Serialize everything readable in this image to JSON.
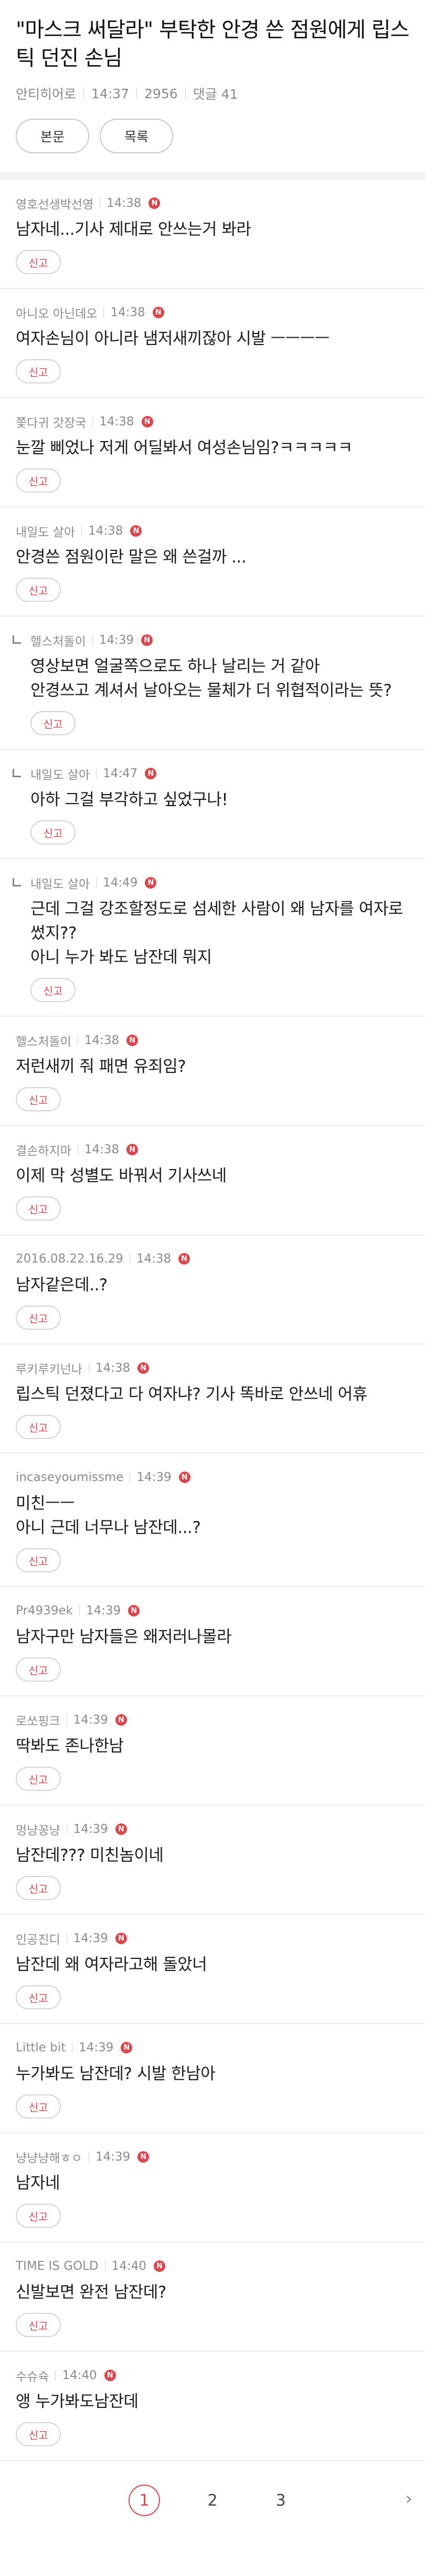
{
  "article": {
    "title": "\"마스크 써달라\" 부탁한 안경 쓴 점원에게 립스틱 던진 손님",
    "author": "안티히어로",
    "time": "14:37",
    "views": "2956",
    "comments_label": "댓글 41",
    "buttons": {
      "body": "본문",
      "list": "목록"
    }
  },
  "report_label": "신고",
  "new_badge": "N",
  "comments": [
    {
      "author": "영호선생박선영",
      "time": "14:38",
      "text": "남자네...기사 제대로 안쓰는거 봐라"
    },
    {
      "author": "아니오 아닌데오",
      "time": "14:38",
      "text": "여자손님이 아니라 냄저새끼잖아 시발 ㅡㅡㅡㅡ"
    },
    {
      "author": "쫓다귀 갓장국",
      "time": "14:38",
      "text": "눈깔 삐었나 저게 어딜봐서 여성손님임?ㅋㅋㅋㅋㅋ"
    },
    {
      "author": "내일도 살아",
      "time": "14:38",
      "text": "안경쓴 점원이란 말은 왜 쓴걸까 ..."
    },
    {
      "author": "헬스처돌이",
      "time": "14:39",
      "text": "영상보면 얼굴쪽으로도 하나 날리는 거 같아\n안경쓰고 계셔서 날아오는 물체가 더 위협적이라는 뜻?",
      "reply": true
    },
    {
      "author": "내일도 살아",
      "time": "14:47",
      "text": "아하 그걸 부각하고 싶었구나!",
      "reply": true
    },
    {
      "author": "내일도 살아",
      "time": "14:49",
      "text": "근데 그걸 강조할정도로 섬세한 사람이 왜 남자를 여자로 썼지??\n아니 누가 봐도 남잔데 뭐지",
      "reply": true
    },
    {
      "author": "헬스처돌이",
      "time": "14:38",
      "text": "저런새끼 줘 패면 유죄임?"
    },
    {
      "author": "결손하지마",
      "time": "14:38",
      "text": "이제 막 성별도 바꿔서 기사쓰네"
    },
    {
      "author": "2016.08.22.16.29",
      "time": "14:38",
      "text": "남자같은데..?"
    },
    {
      "author": "루키루키넌나",
      "time": "14:38",
      "text": "립스틱 던졌다고 다 여자냐? 기사 똑바로 안쓰네 어휴"
    },
    {
      "author": "incaseyoumissme",
      "time": "14:39",
      "text": "미친ㅡㅡ\n아니 근데 너무나 남잔데...?"
    },
    {
      "author": "Pr4939ek",
      "time": "14:39",
      "text": "남자구만 남자들은 왜저러나몰라"
    },
    {
      "author": "로쏘핑크",
      "time": "14:39",
      "text": "딱봐도 존나한남"
    },
    {
      "author": "멍냥꽁냥",
      "time": "14:39",
      "text": "남잔데??? 미친놈이네"
    },
    {
      "author": "인공진디",
      "time": "14:39",
      "text": "남잔데 왜 여자라고해 돌았너"
    },
    {
      "author": "Little bit",
      "time": "14:39",
      "text": "누가봐도 남잔데? 시발 한남아"
    },
    {
      "author": "냥냥냥해ㅎㅇ",
      "time": "14:39",
      "text": "남자네"
    },
    {
      "author": "TIME IS GOLD",
      "time": "14:40",
      "text": "신발보면 완전 남잔데?"
    },
    {
      "author": "수슈슉",
      "time": "14:40",
      "text": "앵 누가봐도남잔데"
    }
  ],
  "pagination": {
    "pages": [
      "1",
      "2",
      "3"
    ],
    "current": "1",
    "next_icon": "chevron-right-icon"
  }
}
